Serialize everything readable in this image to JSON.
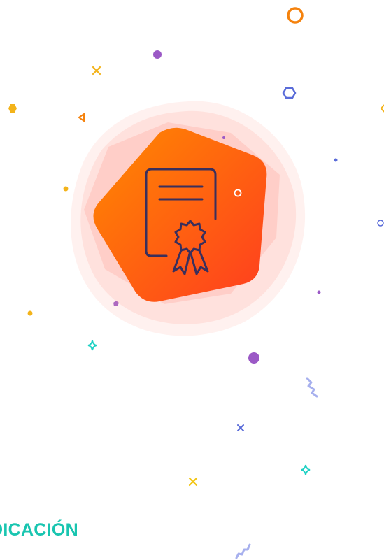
{
  "illustration": {
    "icon": "certificate-with-ribbon-icon",
    "accent_color": "#ff6a00",
    "gradient_from": "#ff8a00",
    "gradient_to": "#ff3d1f",
    "halo_color": "#ffb3a8",
    "icon_stroke_color": "#3a2f5c",
    "confetti_colors": [
      "#f5820d",
      "#9b59c6",
      "#f3b31a",
      "#5a6cd9",
      "#1fd1c4",
      "#f2c514"
    ]
  },
  "heading": {
    "text": "DICACIÓN",
    "color": "#19c5b0"
  }
}
